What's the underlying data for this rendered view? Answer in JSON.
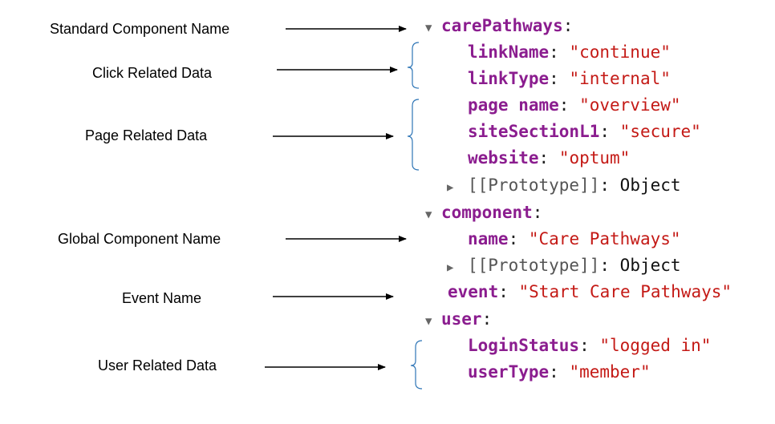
{
  "annotations": [
    {
      "id": "standard",
      "text": "Standard Component Name"
    },
    {
      "id": "click",
      "text": "Click Related Data"
    },
    {
      "id": "page",
      "text": "Page Related Data"
    },
    {
      "id": "global",
      "text": "Global Component Name"
    },
    {
      "id": "event",
      "text": "Event Name"
    },
    {
      "id": "user",
      "text": "User Related Data"
    }
  ],
  "tree": {
    "carePathways_key": "carePathways",
    "linkName_key": "linkName",
    "linkName_val": "\"continue\"",
    "linkType_key": "linkType",
    "linkType_val": "\"internal\"",
    "pagename_key": "page name",
    "pagename_val": "\"overview\"",
    "siteSection_key": "siteSectionL1",
    "siteSection_val": "\"secure\"",
    "website_key": "website",
    "website_val": "\"optum\"",
    "proto_label": "[[Prototype]]",
    "proto_type": "Object",
    "component_key": "component",
    "name_key": "name",
    "name_val": "\"Care Pathways\"",
    "event_key": "event",
    "event_val": "\"Start Care Pathways\"",
    "user_key": "user",
    "login_key": "LoginStatus",
    "login_val": "\"logged in\"",
    "userType_key": "userType",
    "userType_val": "\"member\""
  }
}
